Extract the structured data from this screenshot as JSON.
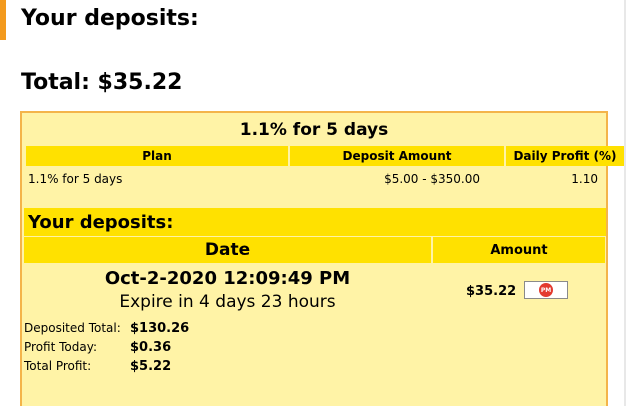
{
  "colors": {
    "accent": "#f39a1e",
    "panel_bg": "#fff3a6",
    "header_bg": "#ffe100",
    "panel_border": "#f4b44a"
  },
  "page": {
    "heading": "Your deposits:",
    "total_label": "Total: $35.22"
  },
  "plan": {
    "title": "1.1% for 5 days",
    "headers": [
      "Plan",
      "Deposit Amount",
      "Daily Profit (%)"
    ],
    "row": {
      "plan": "1.1% for 5 days",
      "deposit_amount": "$5.00 - $350.00",
      "daily_profit": "1.10"
    }
  },
  "deposits": {
    "title": "Your deposits:",
    "col_date": "Date",
    "col_amount": "Amount",
    "date": "Oct-2-2020 12:09:49 PM",
    "expire": "Expire in 4 days 23 hours",
    "amount": "$35.22",
    "payment_icon": "perfect-money-icon",
    "payment_icon_text": "PM"
  },
  "summary": [
    {
      "label": "Deposited Total:",
      "value": "$130.26"
    },
    {
      "label": "Profit Today:",
      "value": "$0.36"
    },
    {
      "label": "Total Profit:",
      "value": "$5.22"
    }
  ]
}
